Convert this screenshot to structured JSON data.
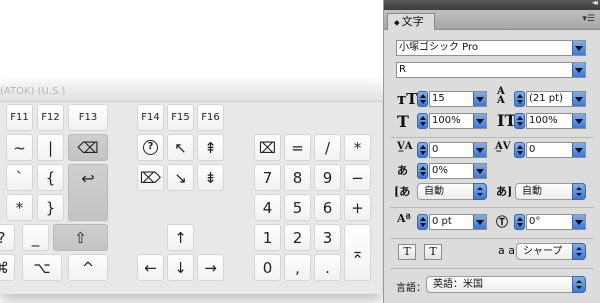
{
  "keyboard": {
    "title": "(ATOK)  (U.S.)",
    "keys": {
      "f11": "F11",
      "f12": "F12",
      "f13": "F13",
      "f14": "F14",
      "f15": "F15",
      "f16": "F16",
      "tilde": "~",
      "pipe": "|",
      "backtick": "`",
      "lbrace": "{",
      "asterisk_left": "*",
      "rbrace": "}",
      "question": "?",
      "underscore": "_",
      "command": "⌘",
      "option": "⌥",
      "control": "^",
      "help": "?",
      "north_west": "↖",
      "page_up": "⇞",
      "page_down": "⇟",
      "south_east": "↘",
      "clear": "⌧",
      "equals": "=",
      "slash": "/",
      "multiply": "*",
      "n7": "7",
      "n8": "8",
      "n9": "9",
      "minus": "−",
      "n4": "4",
      "n5": "5",
      "n6": "6",
      "plus": "+",
      "n1": "1",
      "n2": "2",
      "n3": "3",
      "enter": "⌅",
      "n0": "0",
      "comma": ",",
      "period": ".",
      "up": "↑",
      "left": "←",
      "down": "↓",
      "right": "→",
      "shift": "⇧",
      "return": "↩",
      "delete": "⌫",
      "fwd_delete": "⌦"
    }
  },
  "panel": {
    "tab_label": "文字",
    "font_family": "小塚ゴシック Pro",
    "font_style": "R",
    "font_size": "15",
    "leading": "(21 pt)",
    "vertical_scale": "100%",
    "horizontal_scale": "100%",
    "kerning": "0",
    "tracking": "0",
    "tsume": "0%",
    "aki_left": "自動",
    "aki_right": "自動",
    "baseline_shift": "0 pt",
    "rotation": "0°",
    "antialias_icon": "a a",
    "antialias_value": "シャープ",
    "language_label": "言語：",
    "language_value": "英語：米国",
    "tcy_label": "T",
    "warichu_label": "T"
  },
  "colors": {
    "accent": "#3a78d4",
    "panel_bg": "#dcdcdc",
    "keyboard_bg": "#e8e8e8"
  }
}
